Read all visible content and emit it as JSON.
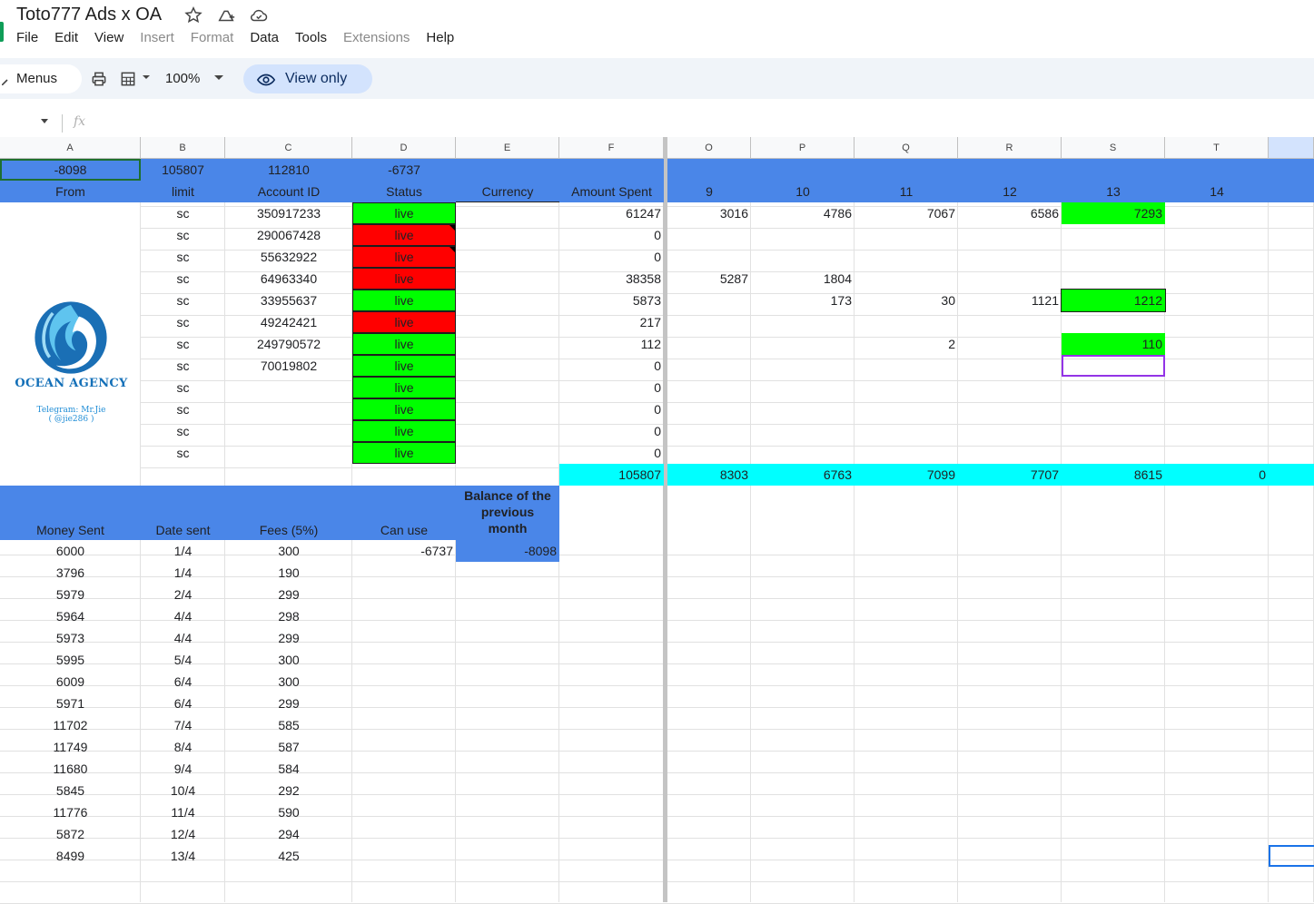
{
  "window": {
    "title": "Toto777 Ads x OA",
    "icons": [
      "star-icon",
      "move-to-drive-icon",
      "cloud-status-icon"
    ]
  },
  "menu": [
    "File",
    "Edit",
    "View",
    "Insert",
    "Format",
    "Data",
    "Tools",
    "Extensions",
    "Help"
  ],
  "menu_disabled": [
    "Insert",
    "Format",
    "Extensions"
  ],
  "toolbar": {
    "menus_label": "Menus",
    "zoom": "100%",
    "view_only_label": "View only"
  },
  "formula_bar": {
    "fx": "fx"
  },
  "columns": [
    "A",
    "B",
    "C",
    "D",
    "E",
    "F",
    "O",
    "P",
    "Q",
    "R",
    "S",
    "T"
  ],
  "row1": {
    "A": "-8098",
    "B": "105807",
    "C": "112810",
    "D": "-6737"
  },
  "row2": {
    "A": "From",
    "B": "limit",
    "C": "Account ID",
    "D": "Status",
    "E": "Currency",
    "F": "Amount Spent",
    "O": "9",
    "P": "10",
    "Q": "11",
    "R": "12",
    "S": "13",
    "T": "14"
  },
  "accounts": [
    {
      "limit": "sc",
      "id": "350917233",
      "status": "live",
      "state": "green",
      "spent": "61247",
      "O": "3016",
      "P": "4786",
      "Q": "7067",
      "R": "6586",
      "S": "7293",
      "S_fill": "green"
    },
    {
      "limit": "sc",
      "id": "290067428",
      "status": "live",
      "state": "red",
      "spent": "0",
      "note": true
    },
    {
      "limit": "sc",
      "id": "55632922",
      "status": "live",
      "state": "red",
      "spent": "0",
      "note": true
    },
    {
      "limit": "sc",
      "id": "64963340",
      "status": "live",
      "state": "red",
      "spent": "38358",
      "O": "5287",
      "P": "1804"
    },
    {
      "limit": "sc",
      "id": "33955637",
      "status": "live",
      "state": "green",
      "spent": "5873",
      "P": "173",
      "Q": "30",
      "R": "1121",
      "S": "1212",
      "S_fill": "green"
    },
    {
      "limit": "sc",
      "id": "49242421",
      "status": "live",
      "state": "red",
      "spent": "217"
    },
    {
      "limit": "sc",
      "id": "249790572",
      "status": "live",
      "state": "green",
      "spent": "112",
      "Q": "2",
      "S": "110",
      "S_fill": "green"
    },
    {
      "limit": "sc",
      "id": "70019802",
      "status": "live",
      "state": "green",
      "spent": "0"
    },
    {
      "limit": "sc",
      "id": "",
      "status": "live",
      "state": "green",
      "spent": "0"
    },
    {
      "limit": "sc",
      "id": "",
      "status": "live",
      "state": "green",
      "spent": "0"
    },
    {
      "limit": "sc",
      "id": "",
      "status": "live",
      "state": "green",
      "spent": "0"
    },
    {
      "limit": "sc",
      "id": "",
      "status": "live",
      "state": "green",
      "spent": "0"
    }
  ],
  "totals": {
    "F": "105807",
    "O": "8303",
    "P": "6763",
    "Q": "7099",
    "R": "7707",
    "S": "8615",
    "T": "0"
  },
  "payments_header": {
    "A": "Money Sent",
    "B": "Date sent",
    "C": "Fees (5%)",
    "D": "Can use",
    "E": "Balance of the previous month"
  },
  "payments_summary": {
    "D": "-6737",
    "E": "-8098"
  },
  "payments": [
    {
      "money": "6000",
      "date": "1/4",
      "fee": "300"
    },
    {
      "money": "3796",
      "date": "1/4",
      "fee": "190"
    },
    {
      "money": "5979",
      "date": "2/4",
      "fee": "299"
    },
    {
      "money": "5964",
      "date": "4/4",
      "fee": "298"
    },
    {
      "money": "5973",
      "date": "4/4",
      "fee": "299"
    },
    {
      "money": "5995",
      "date": "5/4",
      "fee": "300"
    },
    {
      "money": "6009",
      "date": "6/4",
      "fee": "300"
    },
    {
      "money": "5971",
      "date": "6/4",
      "fee": "299"
    },
    {
      "money": "11702",
      "date": "7/4",
      "fee": "585"
    },
    {
      "money": "11749",
      "date": "8/4",
      "fee": "587"
    },
    {
      "money": "11680",
      "date": "9/4",
      "fee": "584"
    },
    {
      "money": "5845",
      "date": "10/4",
      "fee": "292"
    },
    {
      "money": "11776",
      "date": "11/4",
      "fee": "590"
    },
    {
      "money": "5872",
      "date": "12/4",
      "fee": "294"
    },
    {
      "money": "8499",
      "date": "13/4",
      "fee": "425"
    }
  ],
  "logo": {
    "name": "OCEAN AGENCY",
    "telegram_line1": "Telegram: Mr.Jie",
    "telegram_line2": "( @jie286 )"
  },
  "colors": {
    "header_blue": "#4a86e8",
    "live_green": "#00ff00",
    "dead_red": "#ff0000",
    "total_cyan": "#00ffff",
    "view_only_bg": "#d3e3fd"
  }
}
